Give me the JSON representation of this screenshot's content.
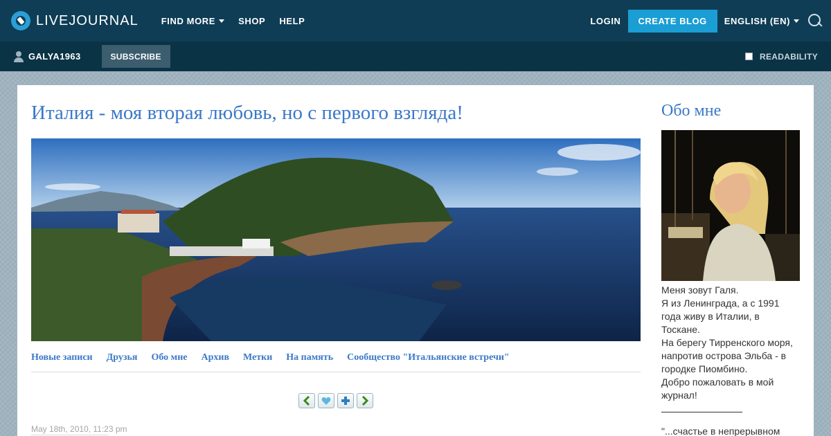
{
  "header": {
    "logo_text": "LIVEJOURNAL",
    "nav": [
      {
        "label": "FIND MORE",
        "has_dropdown": true
      },
      {
        "label": "SHOP",
        "has_dropdown": false
      },
      {
        "label": "HELP",
        "has_dropdown": false
      }
    ],
    "login_label": "LOGIN",
    "create_blog_label": "CREATE BLOG",
    "language_label": "ENGLISH (EN)",
    "search_icon": "search-icon",
    "colors": {
      "bar": "#0e3d55",
      "accent": "#1a9ed4"
    }
  },
  "subbar": {
    "username": "GALYA1963",
    "subscribe_label": "SUBSCRIBE",
    "readability_label": "READABILITY",
    "readability_checked": false
  },
  "post": {
    "journal_title": "Италия - моя вторая любовь, но с первого взгляда!",
    "nav_links": [
      "Новые записи",
      "Друзья",
      "Обо мне",
      "Архив",
      "Метки",
      "На память",
      "Сообщество \"Итальянские встречи\""
    ],
    "tools": [
      "prev-arrow-icon",
      "heart-icon",
      "add-icon",
      "next-arrow-icon"
    ],
    "date": "May 18th, 2010, 11:23 pm"
  },
  "sidebar": {
    "title": "Обо мне",
    "lines": [
      "Меня зовут Галя.",
      "Я из Ленинграда, а с 1991 года живу в Италии, в Тоскане.",
      "На берегу Тирренского моря, напротив острова Эльба - в городке Пиомбино.",
      "Добро пожаловать в мой журнал!"
    ],
    "quote_start": "\"...счастье в непрерывном"
  }
}
